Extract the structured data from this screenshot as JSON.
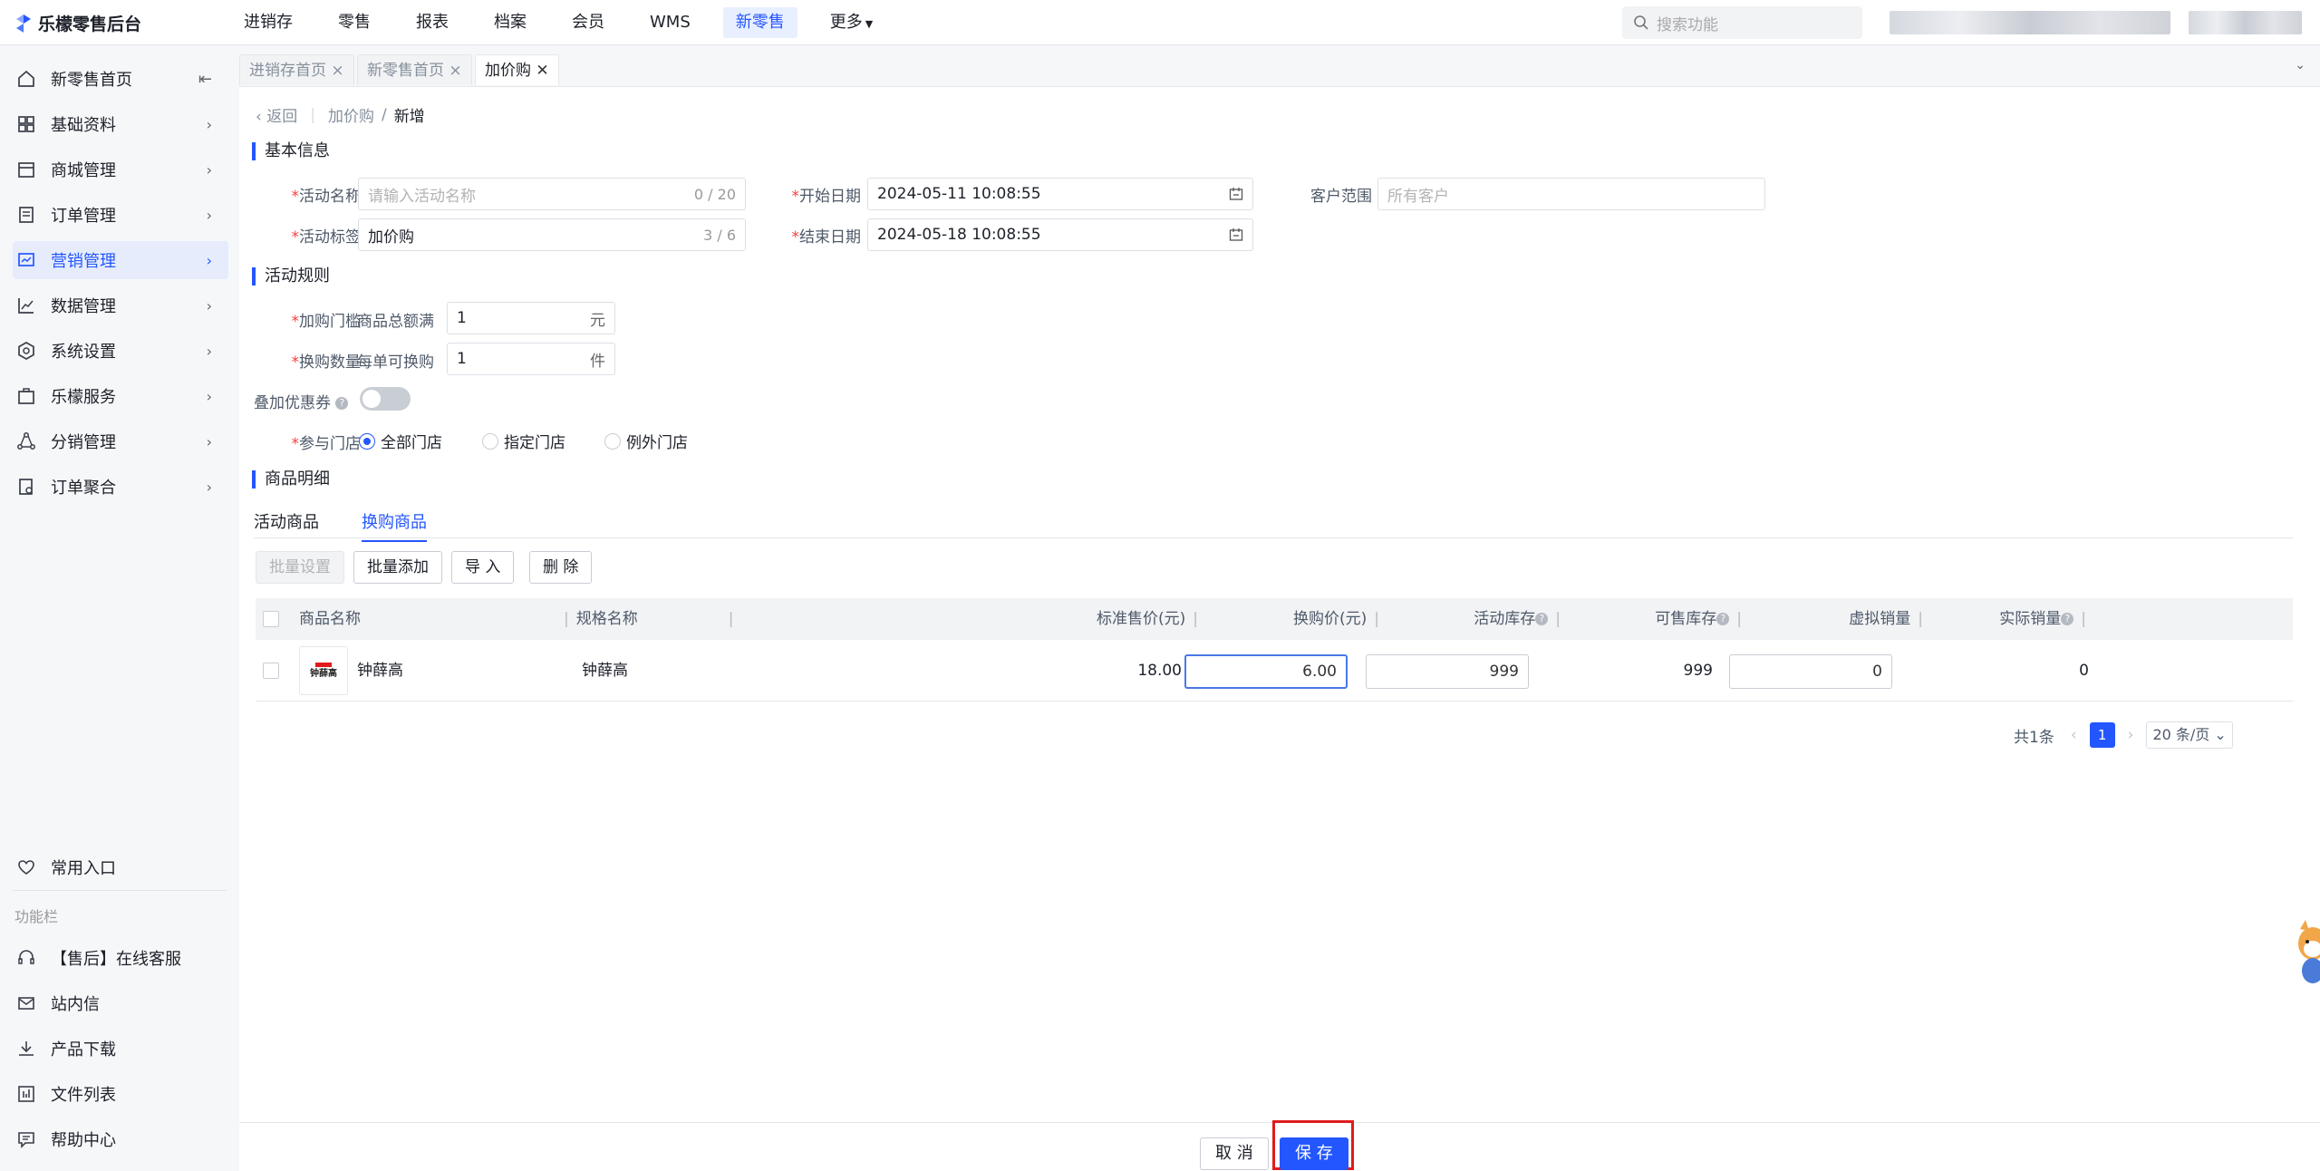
{
  "app": {
    "title": "乐檬零售后台"
  },
  "nav": {
    "items": [
      "进销存",
      "零售",
      "报表",
      "档案",
      "会员",
      "WMS",
      "新零售",
      "更多"
    ],
    "active_index": 6
  },
  "search": {
    "placeholder": "搜索功能"
  },
  "sidebar": {
    "items": [
      {
        "label": "新零售首页",
        "icon": "home-icon"
      },
      {
        "label": "基础资料",
        "icon": "grid-icon"
      },
      {
        "label": "商城管理",
        "icon": "store-icon"
      },
      {
        "label": "订单管理",
        "icon": "order-icon"
      },
      {
        "label": "营销管理",
        "icon": "marketing-icon"
      },
      {
        "label": "数据管理",
        "icon": "chart-line-icon"
      },
      {
        "label": "系统设置",
        "icon": "settings-icon"
      },
      {
        "label": "乐檬服务",
        "icon": "briefcase-icon"
      },
      {
        "label": "分销管理",
        "icon": "share-icon"
      },
      {
        "label": "订单聚合",
        "icon": "aggregate-icon"
      }
    ],
    "active_index": 4,
    "favorites": "常用入口",
    "function_caption": "功能栏",
    "tools": [
      {
        "label": "【售后】在线客服",
        "icon": "headset-icon"
      },
      {
        "label": "站内信",
        "icon": "mail-icon"
      },
      {
        "label": "产品下载",
        "icon": "download-icon"
      },
      {
        "label": "文件列表",
        "icon": "file-list-icon"
      },
      {
        "label": "帮助中心",
        "icon": "help-icon"
      }
    ]
  },
  "tabs": [
    {
      "label": "进销存首页"
    },
    {
      "label": "新零售首页"
    },
    {
      "label": "加价购"
    }
  ],
  "breadcrumb": {
    "back": "返回",
    "parent": "加价购",
    "current": "新增"
  },
  "basic": {
    "title": "基本信息",
    "name_label": "活动名称",
    "name_placeholder": "请输入活动名称",
    "name_count": "0 / 20",
    "tag_label": "活动标签",
    "tag_value": "加价购",
    "tag_count": "3 / 6",
    "start_label": "开始日期",
    "start_value": "2024-05-11 10:08:55",
    "end_label": "结束日期",
    "end_value": "2024-05-18 10:08:55",
    "customer_label": "客户范围",
    "customer_placeholder": "所有客户"
  },
  "rules": {
    "title": "活动规则",
    "threshold_label": "加购门槛",
    "threshold_prefix": "商品总额满",
    "threshold_value": "1",
    "threshold_unit": "元",
    "qty_label": "换购数量",
    "qty_prefix": "每单可换购",
    "qty_value": "1",
    "qty_unit": "件",
    "coupon_label": "叠加优惠券",
    "coupon_enabled": false,
    "stores_label": "参与门店",
    "store_options": [
      "全部门店",
      "指定门店",
      "例外门店"
    ],
    "store_selected": 0
  },
  "goods": {
    "title": "商品明细",
    "tabs": [
      "活动商品",
      "换购商品"
    ],
    "active_tab": 1,
    "buttons": [
      "批量设置",
      "批量添加",
      "导 入",
      "删 除"
    ],
    "columns": [
      "商品名称",
      "规格名称",
      "标准售价(元)",
      "换购价(元)",
      "活动库存",
      "可售库存",
      "虚拟销量",
      "实际销量"
    ],
    "rows": [
      {
        "thumb_text": "钟薛高",
        "name": "钟薛高",
        "spec": "钟薛高",
        "price": "18.00",
        "swap_price": "6.00",
        "activity_stock": "999",
        "sellable_stock": "999",
        "virtual_sales": "0",
        "actual_sales": "0"
      }
    ]
  },
  "pager": {
    "total": "共1条",
    "page": "1",
    "page_size": "20 条/页"
  },
  "footer": {
    "cancel": "取 消",
    "save": "保 存"
  },
  "colors": {
    "primary": "#2456ff",
    "required": "#f53f3f",
    "highlight": "#e01b1b"
  }
}
